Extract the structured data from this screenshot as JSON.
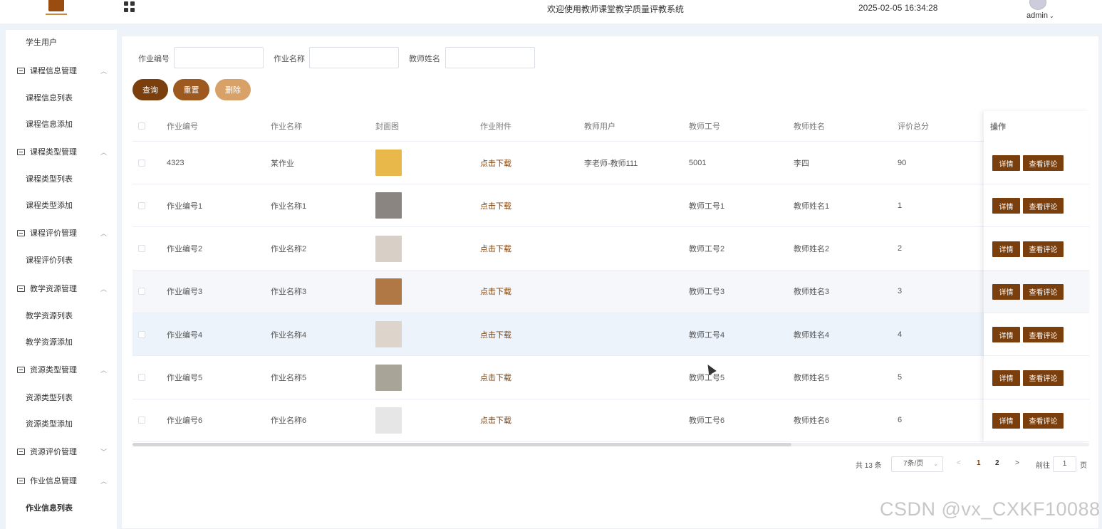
{
  "header": {
    "system_title": "欢迎使用教师课堂教学质量评教系统",
    "datetime": "2025-02-05 16:34:28",
    "user": "admin"
  },
  "sidebar": {
    "items": [
      {
        "label": "学生用户",
        "type": "sub"
      },
      {
        "label": "课程信息管理",
        "type": "group",
        "chevron": "^"
      },
      {
        "label": "课程信息列表",
        "type": "sub"
      },
      {
        "label": "课程信息添加",
        "type": "sub"
      },
      {
        "label": "课程类型管理",
        "type": "group",
        "chevron": "^"
      },
      {
        "label": "课程类型列表",
        "type": "sub"
      },
      {
        "label": "课程类型添加",
        "type": "sub"
      },
      {
        "label": "课程评价管理",
        "type": "group",
        "chevron": "^"
      },
      {
        "label": "课程评价列表",
        "type": "sub"
      },
      {
        "label": "教学资源管理",
        "type": "group",
        "chevron": "^"
      },
      {
        "label": "教学资源列表",
        "type": "sub"
      },
      {
        "label": "教学资源添加",
        "type": "sub"
      },
      {
        "label": "资源类型管理",
        "type": "group",
        "chevron": "^"
      },
      {
        "label": "资源类型列表",
        "type": "sub"
      },
      {
        "label": "资源类型添加",
        "type": "sub"
      },
      {
        "label": "资源评价管理",
        "type": "group",
        "chevron": "v"
      },
      {
        "label": "作业信息管理",
        "type": "group",
        "chevron": "^"
      },
      {
        "label": "作业信息列表",
        "type": "sub",
        "active": true
      }
    ]
  },
  "search": {
    "label_code": "作业编号",
    "label_name": "作业名称",
    "label_teacher": "教师姓名",
    "value_code": "",
    "value_name": "",
    "value_teacher": ""
  },
  "buttons": {
    "query": "查询",
    "reset": "重置",
    "delete": "删除"
  },
  "table": {
    "columns": [
      "作业编号",
      "作业名称",
      "封面图",
      "作业附件",
      "教师用户",
      "教师工号",
      "教师姓名",
      "评价总分",
      "操作"
    ],
    "rows": [
      {
        "code": "4323",
        "name": "某作业",
        "attachment": "点击下载",
        "teacher_user": "李老师-教师111",
        "teacher_no": "5001",
        "teacher_name": "李四",
        "score": "90",
        "thumb_color": "#e8b94a"
      },
      {
        "code": "作业编号1",
        "name": "作业名称1",
        "attachment": "点击下载",
        "teacher_user": "",
        "teacher_no": "教师工号1",
        "teacher_name": "教师姓名1",
        "score": "1",
        "thumb_color": "#8a8580"
      },
      {
        "code": "作业编号2",
        "name": "作业名称2",
        "attachment": "点击下载",
        "teacher_user": "",
        "teacher_no": "教师工号2",
        "teacher_name": "教师姓名2",
        "score": "2",
        "thumb_color": "#d8cfc6"
      },
      {
        "code": "作业编号3",
        "name": "作业名称3",
        "attachment": "点击下载",
        "teacher_user": "",
        "teacher_no": "教师工号3",
        "teacher_name": "教师姓名3",
        "score": "3",
        "thumb_color": "#b07845"
      },
      {
        "code": "作业编号4",
        "name": "作业名称4",
        "attachment": "点击下载",
        "teacher_user": "",
        "teacher_no": "教师工号4",
        "teacher_name": "教师姓名4",
        "score": "4",
        "thumb_color": "#ddd4cc"
      },
      {
        "code": "作业编号5",
        "name": "作业名称5",
        "attachment": "点击下载",
        "teacher_user": "",
        "teacher_no": "教师工号5",
        "teacher_name": "教师姓名5",
        "score": "5",
        "thumb_color": "#a8a498"
      },
      {
        "code": "作业编号6",
        "name": "作业名称6",
        "attachment": "点击下载",
        "teacher_user": "",
        "teacher_no": "教师工号6",
        "teacher_name": "教师姓名6",
        "score": "6",
        "thumb_color": "#e6e6e6"
      }
    ],
    "action_detail": "详情",
    "action_comments": "查看评论"
  },
  "pager": {
    "total": "共 13 条",
    "page_size": "7条/页",
    "prev": "<",
    "pages": [
      "1",
      "2"
    ],
    "next": ">",
    "goto_prefix": "前往",
    "goto_value": "1",
    "goto_suffix": "页"
  },
  "watermark": "CSDN @vx_CXKF10088",
  "colors": {
    "accent": "#7a3f0c",
    "reset": "#9e5a1e",
    "delete": "#d8a167"
  }
}
